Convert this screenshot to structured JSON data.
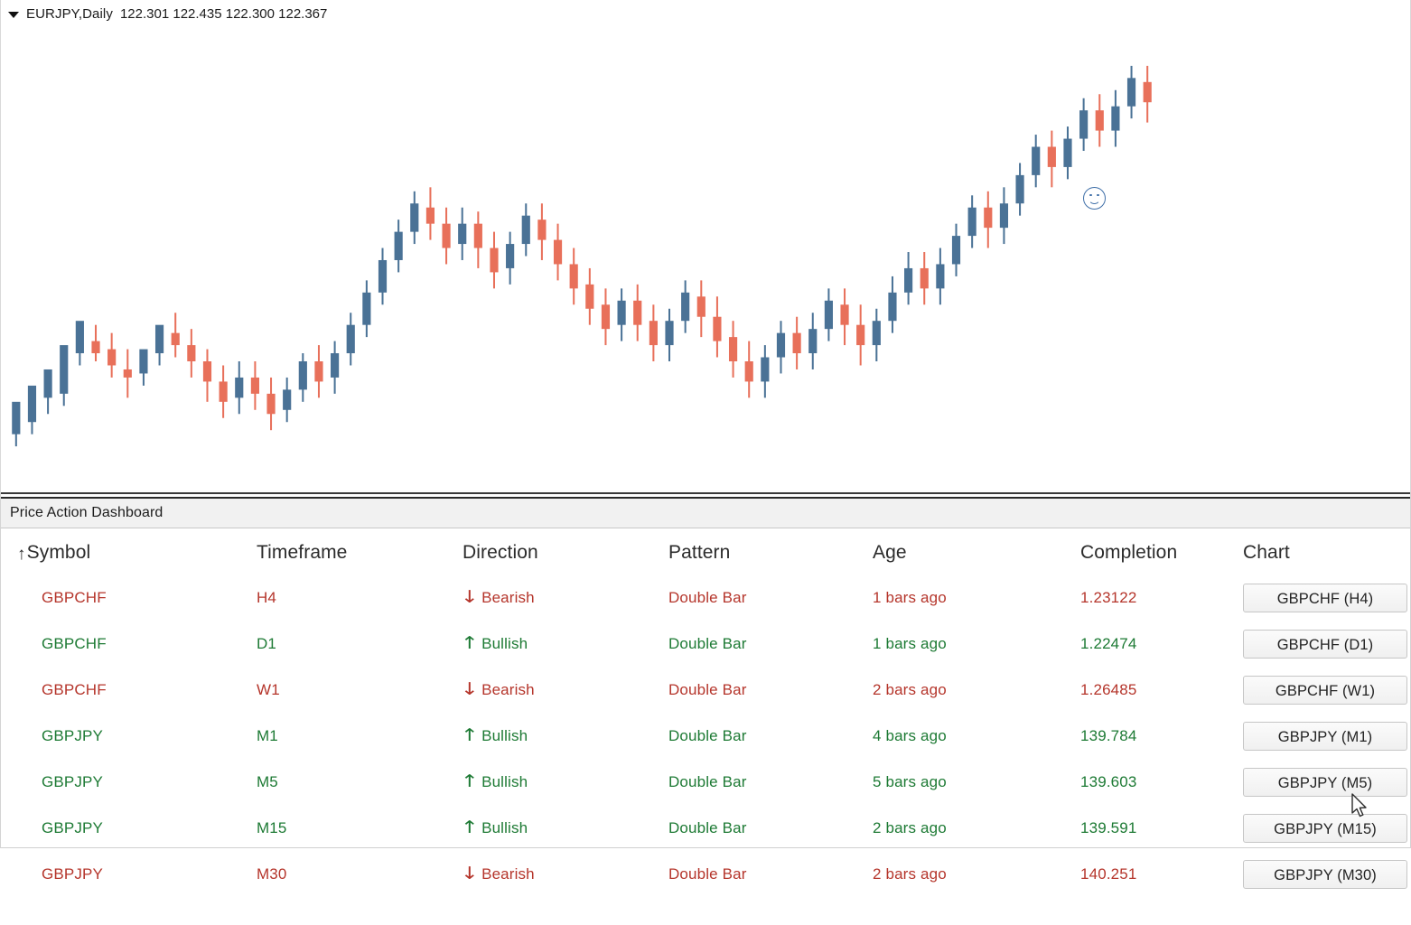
{
  "chart": {
    "dropdown_icon": "triangle-down-icon",
    "symbol_label": "EURJPY,Daily",
    "ohlc": "122.301 122.435 122.300 122.367",
    "marker_icon": "smiley-face-icon",
    "bull_color": "#4a7296",
    "bear_color": "#e8705a"
  },
  "dashboard": {
    "title": "Price Action Dashboard",
    "sort_arrow": "↑",
    "headers": {
      "symbol": "Symbol",
      "timeframe": "Timeframe",
      "direction": "Direction",
      "pattern": "Pattern",
      "age": "Age",
      "completion": "Completion",
      "chart": "Chart"
    },
    "colors": {
      "bullish": "#1d7a34",
      "bearish": "#b5352b"
    },
    "rows": [
      {
        "symbol": "GBPCHF",
        "timeframe": "H4",
        "direction": "Bearish",
        "arrow": "↓",
        "pattern": "Double Bar",
        "age": "1 bars ago",
        "completion": "1.23122",
        "button": "GBPCHF (H4)",
        "state": "bear"
      },
      {
        "symbol": "GBPCHF",
        "timeframe": "D1",
        "direction": "Bullish",
        "arrow": "↑",
        "pattern": "Double Bar",
        "age": "1 bars ago",
        "completion": "1.22474",
        "button": "GBPCHF (D1)",
        "state": "bull"
      },
      {
        "symbol": "GBPCHF",
        "timeframe": "W1",
        "direction": "Bearish",
        "arrow": "↓",
        "pattern": "Double Bar",
        "age": "2 bars ago",
        "completion": "1.26485",
        "button": "GBPCHF (W1)",
        "state": "bear"
      },
      {
        "symbol": "GBPJPY",
        "timeframe": "M1",
        "direction": "Bullish",
        "arrow": "↑",
        "pattern": "Double Bar",
        "age": "4 bars ago",
        "completion": "139.784",
        "button": "GBPJPY (M1)",
        "state": "bull"
      },
      {
        "symbol": "GBPJPY",
        "timeframe": "M5",
        "direction": "Bullish",
        "arrow": "↑",
        "pattern": "Double Bar",
        "age": "5 bars ago",
        "completion": "139.603",
        "button": "GBPJPY (M5)",
        "state": "bull"
      },
      {
        "symbol": "GBPJPY",
        "timeframe": "M15",
        "direction": "Bullish",
        "arrow": "↑",
        "pattern": "Double Bar",
        "age": "2 bars ago",
        "completion": "139.591",
        "button": "GBPJPY (M15)",
        "state": "bull"
      },
      {
        "symbol": "GBPJPY",
        "timeframe": "M30",
        "direction": "Bearish",
        "arrow": "↓",
        "pattern": "Double Bar",
        "age": "2 bars ago",
        "completion": "140.251",
        "button": "GBPJPY (M30)",
        "state": "bear"
      }
    ]
  },
  "chart_data": {
    "type": "candlestick",
    "title": "EURJPY,Daily",
    "ohlc_quote": {
      "open": 122.301,
      "high": 122.435,
      "low": 122.3,
      "close": 122.367
    },
    "xlabel": "",
    "ylabel": "",
    "grid": false,
    "legend": "none",
    "bars": [
      [
        6,
        14,
        3,
        11
      ],
      [
        9,
        18,
        6,
        15
      ],
      [
        15,
        22,
        11,
        17
      ],
      [
        16,
        28,
        13,
        26
      ],
      [
        26,
        34,
        23,
        30
      ],
      [
        29,
        26,
        24,
        33
      ],
      [
        27,
        23,
        20,
        31
      ],
      [
        22,
        20,
        15,
        27
      ],
      [
        21,
        27,
        18,
        25
      ],
      [
        26,
        33,
        23,
        30
      ],
      [
        31,
        28,
        25,
        36
      ],
      [
        28,
        24,
        20,
        32
      ],
      [
        24,
        19,
        14,
        27
      ],
      [
        19,
        14,
        10,
        23
      ],
      [
        15,
        20,
        11,
        24
      ],
      [
        20,
        16,
        12,
        24
      ],
      [
        16,
        11,
        7,
        20
      ],
      [
        12,
        17,
        9,
        20
      ],
      [
        17,
        24,
        14,
        26
      ],
      [
        24,
        19,
        15,
        28
      ],
      [
        20,
        26,
        16,
        29
      ],
      [
        26,
        33,
        23,
        36
      ],
      [
        33,
        41,
        30,
        44
      ],
      [
        41,
        49,
        38,
        52
      ],
      [
        49,
        56,
        46,
        59
      ],
      [
        56,
        63,
        53,
        66
      ],
      [
        62,
        58,
        54,
        67
      ],
      [
        58,
        52,
        48,
        62
      ],
      [
        53,
        58,
        49,
        62
      ],
      [
        58,
        52,
        47,
        61
      ],
      [
        52,
        46,
        42,
        56
      ],
      [
        47,
        53,
        43,
        56
      ],
      [
        53,
        60,
        50,
        63
      ],
      [
        59,
        54,
        49,
        63
      ],
      [
        54,
        48,
        44,
        58
      ],
      [
        48,
        42,
        38,
        52
      ],
      [
        43,
        37,
        33,
        47
      ],
      [
        38,
        32,
        28,
        42
      ],
      [
        33,
        39,
        29,
        42
      ],
      [
        39,
        33,
        29,
        43
      ],
      [
        34,
        28,
        24,
        38
      ],
      [
        28,
        34,
        24,
        37
      ],
      [
        34,
        41,
        31,
        44
      ],
      [
        40,
        35,
        30,
        44
      ],
      [
        35,
        29,
        25,
        40
      ],
      [
        30,
        24,
        20,
        34
      ],
      [
        24,
        19,
        15,
        29
      ],
      [
        19,
        25,
        15,
        28
      ],
      [
        25,
        31,
        21,
        34
      ],
      [
        31,
        26,
        22,
        35
      ],
      [
        26,
        32,
        22,
        36
      ],
      [
        32,
        39,
        29,
        42
      ],
      [
        38,
        33,
        28,
        42
      ],
      [
        33,
        28,
        23,
        38
      ],
      [
        28,
        34,
        24,
        37
      ],
      [
        34,
        41,
        31,
        45
      ],
      [
        41,
        47,
        38,
        51
      ],
      [
        47,
        42,
        38,
        51
      ],
      [
        42,
        48,
        38,
        52
      ],
      [
        48,
        55,
        45,
        58
      ],
      [
        55,
        62,
        52,
        65
      ],
      [
        62,
        57,
        52,
        66
      ],
      [
        57,
        63,
        53,
        67
      ],
      [
        63,
        70,
        60,
        73
      ],
      [
        70,
        77,
        67,
        80
      ],
      [
        77,
        72,
        67,
        81
      ],
      [
        72,
        79,
        69,
        82
      ],
      [
        79,
        86,
        76,
        89
      ],
      [
        86,
        81,
        77,
        90
      ],
      [
        81,
        87,
        77,
        91
      ],
      [
        87,
        94,
        84,
        97
      ],
      [
        93,
        88,
        83,
        97
      ]
    ],
    "note": "Approximate schematic OHLC values; bars rise from lower-left to a peak near the right-centre then drift down and rally at the far right."
  }
}
